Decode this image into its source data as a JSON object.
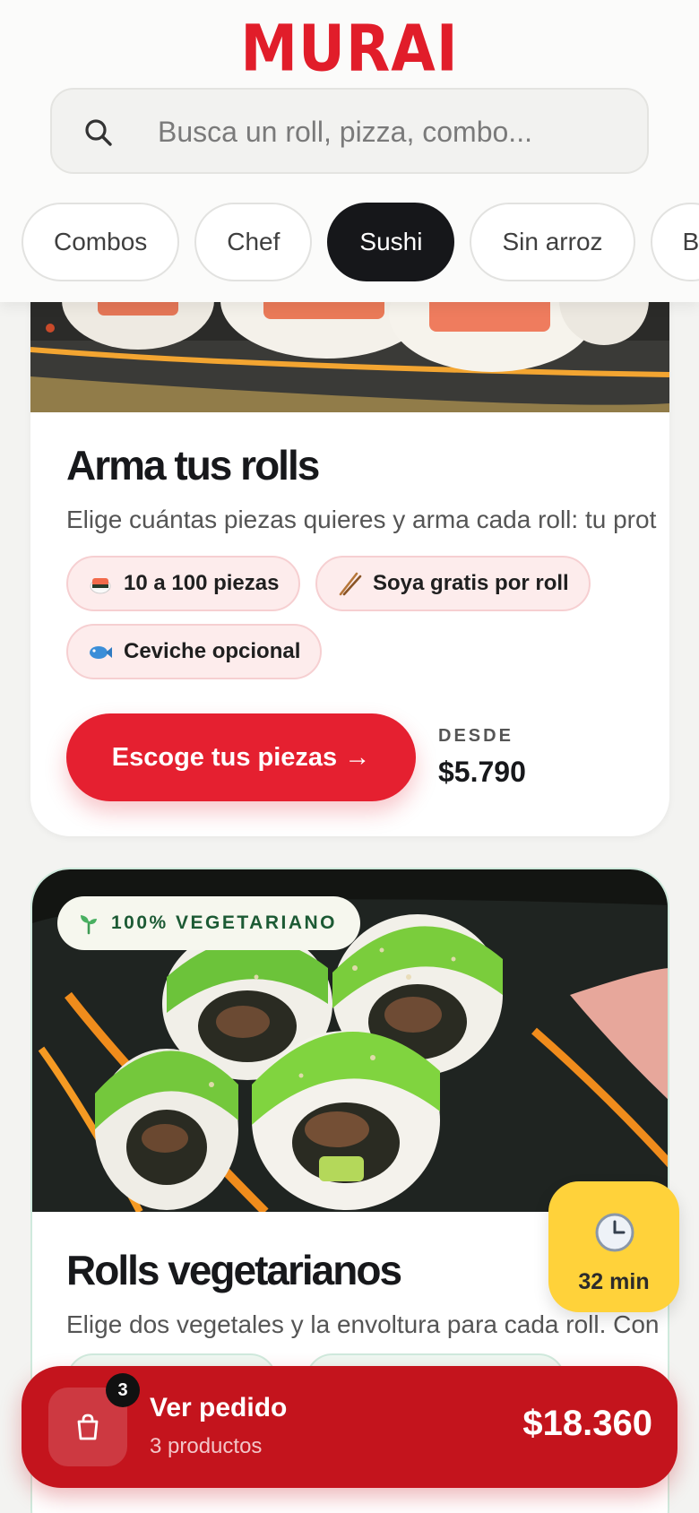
{
  "brand": {
    "logo": "MURAI",
    "accent": "#e11d2a"
  },
  "search": {
    "placeholder": "Busca un roll, pizza, combo..."
  },
  "categories": [
    {
      "label": "Combos",
      "active": false
    },
    {
      "label": "Chef",
      "active": false
    },
    {
      "label": "Sushi",
      "active": true
    },
    {
      "label": "Sin arroz",
      "active": false
    },
    {
      "label": "B",
      "active": false
    }
  ],
  "cards": [
    {
      "title": "Arma tus rolls",
      "description": "Elige cuántas piezas quieres y arma cada roll: tu prot",
      "tags": [
        {
          "icon": "sushi-icon",
          "label": "10 a 100 piezas"
        },
        {
          "icon": "chopsticks-icon",
          "label": "Soya gratis por roll"
        },
        {
          "icon": "fish-icon",
          "label": "Ceviche opcional"
        }
      ],
      "cta": "Escoge tus piezas →",
      "price_label": "DESDE",
      "price": "$5.790"
    },
    {
      "badge": "100% VEGETARIANO",
      "badge_icon": "sprout-icon",
      "title": "Rolls vegetarianos",
      "description": "Elige dos vegetales y la envoltura para cada roll. Con"
    }
  ],
  "timer": {
    "icon": "clock-icon",
    "label": "32 min"
  },
  "order": {
    "icon": "shopping-bag-icon",
    "count": "3",
    "title": "Ver pedido",
    "subtitle": "3 productos",
    "total": "$18.360"
  }
}
